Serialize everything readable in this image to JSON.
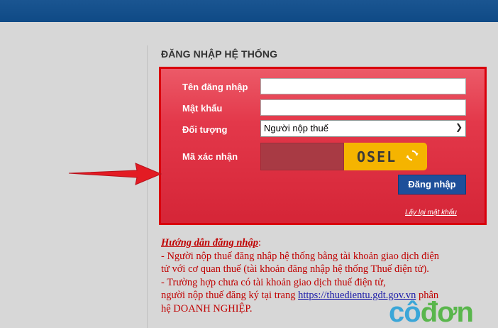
{
  "header": {
    "color": "#13508e"
  },
  "login": {
    "title": "ĐĂNG NHẬP HỆ THỐNG",
    "username_label": "Tên đăng nhập",
    "password_label": "Mật khẩu",
    "type_label": "Đối tượng",
    "type_value": "Người nộp thuế",
    "captcha_label": "Mã xác nhận",
    "captcha_text": "OSEL",
    "submit_label": "Đăng nhập",
    "forgot_link": "Lấy lại mật khẩu"
  },
  "guide": {
    "title": "Hướng dẫn đăng nhập",
    "line1a": "- Người nộp thuế đăng nhập hệ thống bằng tài khoản giao dịch điện",
    "line1b": "tử với cơ quan thuế (tài khoản đăng nhập hệ thống Thuế điện tử).",
    "line2a": "- Trường hợp chưa có tài khoản giao dịch thuế điện tử,",
    "line2b_prefix": "người nộp thuế đăng ký tại trang ",
    "link": "https://thuedientu.gdt.gov.vn",
    "line2b_suffix": " phân",
    "line3": "hệ DOANH NGHIỆP."
  },
  "watermark": {
    "part1": "cô",
    "part2": "đơn"
  },
  "icons": [
    "refresh-icon",
    "red-arrow-icon",
    "chevron-down-icon"
  ]
}
